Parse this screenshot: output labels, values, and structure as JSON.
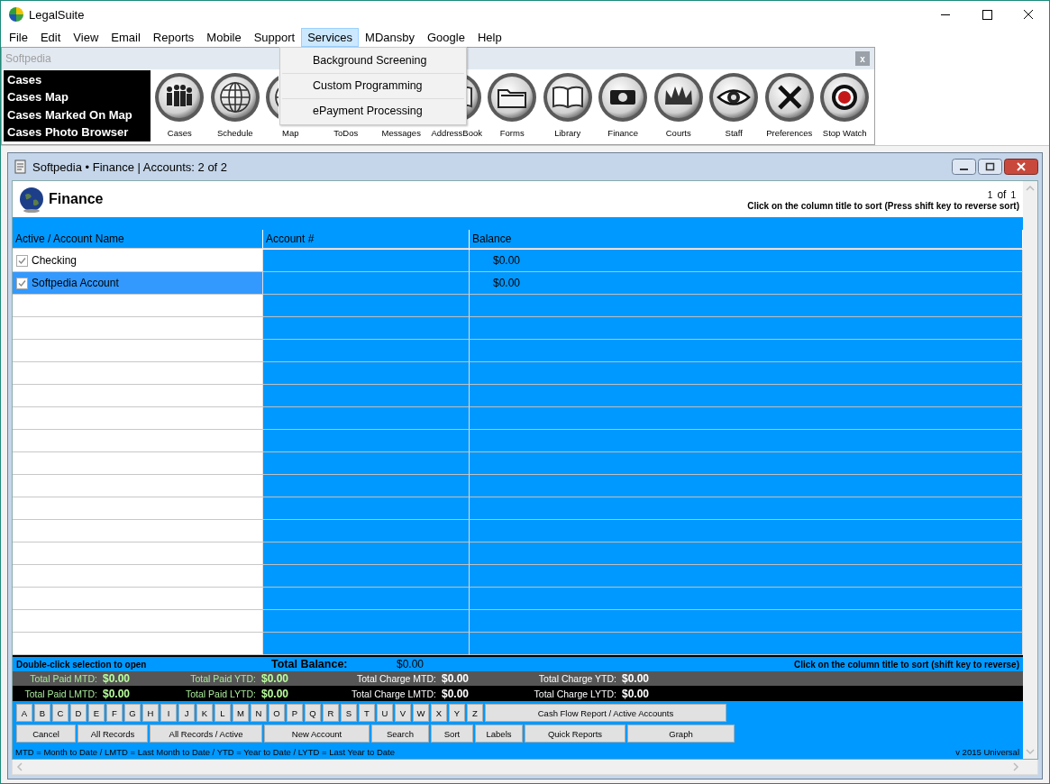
{
  "app": {
    "title": "LegalSuite"
  },
  "menu": [
    {
      "label": "File",
      "selected": false
    },
    {
      "label": "Edit",
      "selected": false
    },
    {
      "label": "View",
      "selected": false
    },
    {
      "label": "Email",
      "selected": false
    },
    {
      "label": "Reports",
      "selected": false
    },
    {
      "label": "Mobile",
      "selected": false
    },
    {
      "label": "Support",
      "selected": false
    },
    {
      "label": "Services",
      "selected": true
    },
    {
      "label": "MDansby",
      "selected": false
    },
    {
      "label": "Google",
      "selected": false
    },
    {
      "label": "Help",
      "selected": false
    }
  ],
  "services_menu": [
    "Background Screening",
    "Custom Programming",
    "ePayment Processing"
  ],
  "toolbar": {
    "title": "Softpedia",
    "close": "x",
    "links": [
      "Cases",
      "Cases Map",
      "Cases Marked On Map",
      "Cases Photo Browser"
    ],
    "items": [
      "Cases",
      "Schedule",
      "Map",
      "ToDos",
      "Messages",
      "AddressBook",
      "Forms",
      "Library",
      "Finance",
      "Courts",
      "Staff",
      "Preferences",
      "Stop Watch"
    ]
  },
  "child": {
    "title": "Softpedia  •  Finance | Accounts: 2 of 2",
    "heading": "Finance",
    "page": "1",
    "page_of": "of",
    "page_total": "1",
    "sort_hint": "Click on the column title to sort (Press shift key to reverse sort)"
  },
  "table": {
    "columns": [
      "Active / Account Name",
      "Account #",
      "Balance"
    ],
    "rows": [
      {
        "name": "Checking",
        "checked": true,
        "selected": false,
        "balance": "$0.00"
      },
      {
        "name": "Softpedia Account",
        "checked": true,
        "selected": true,
        "balance": "$0.00"
      }
    ]
  },
  "footer": {
    "open_hint": "Double-click selection to open",
    "total_label": "Total Balance:",
    "total_value": "$0.00",
    "sort_hint": "Click on the column title to sort (shift key to reverse)",
    "totals": [
      [
        {
          "kind": "paid",
          "label": "Total Paid MTD:",
          "value": "$0.00"
        },
        {
          "kind": "paid",
          "label": "Total Paid YTD:",
          "value": "$0.00"
        },
        {
          "kind": "charge",
          "label": "Total Charge MTD:",
          "value": "$0.00"
        },
        {
          "kind": "charge",
          "label": "Total Charge YTD:",
          "value": "$0.00"
        }
      ],
      [
        {
          "kind": "paid",
          "label": "Total Paid LMTD:",
          "value": "$0.00"
        },
        {
          "kind": "paid",
          "label": "Total Paid LYTD:",
          "value": "$0.00"
        },
        {
          "kind": "charge",
          "label": "Total Charge LMTD:",
          "value": "$0.00"
        },
        {
          "kind": "charge",
          "label": "Total Charge LYTD:",
          "value": "$0.00"
        }
      ]
    ],
    "letters": [
      "A",
      "B",
      "C",
      "D",
      "E",
      "F",
      "G",
      "H",
      "I",
      "J",
      "K",
      "L",
      "M",
      "N",
      "O",
      "P",
      "Q",
      "R",
      "S",
      "T",
      "U",
      "V",
      "W",
      "X",
      "Y",
      "Z"
    ],
    "report_button": "Cash Flow Report / Active Accounts",
    "buttons": [
      "Cancel",
      "All Records",
      "All Records / Active",
      "New Account",
      "Search",
      "Sort",
      "Labels",
      "Quick Reports",
      "Graph"
    ],
    "legend": "MTD = Month to Date  /  LMTD = Last Month to Date  /  YTD = Year to Date  /  LYTD = Last Year to Date",
    "version": "v 2015 Universal"
  }
}
